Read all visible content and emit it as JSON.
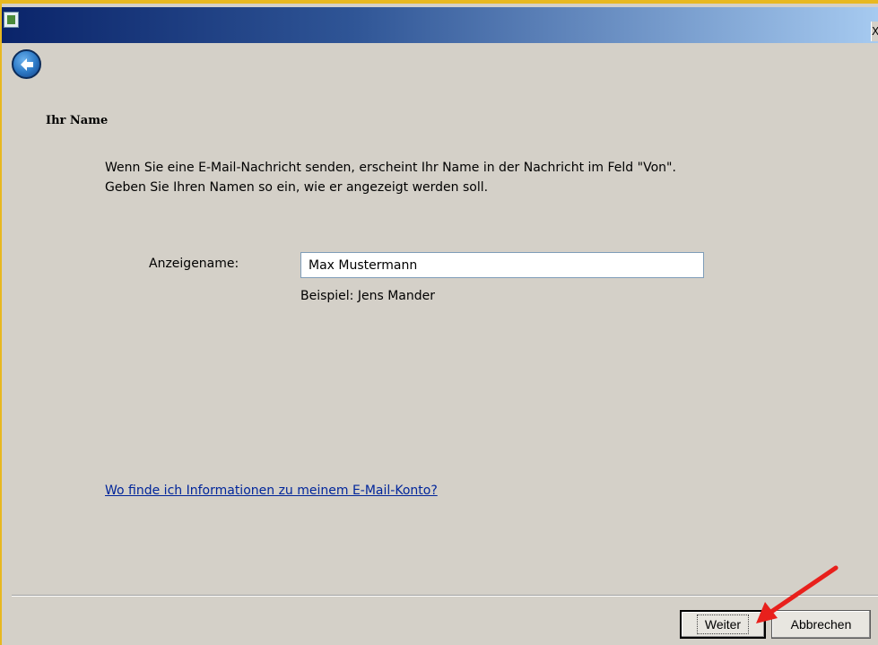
{
  "titlebar": {
    "icon": "app-icon",
    "close_glyph": "X"
  },
  "back_button": {
    "icon": "back-arrow-icon"
  },
  "page": {
    "heading": "Ihr Name",
    "description": "Wenn Sie eine E-Mail-Nachricht senden, erscheint Ihr Name in der Nachricht im Feld \"Von\". Geben Sie Ihren Namen so ein, wie er angezeigt werden soll."
  },
  "form": {
    "display_name_label": "Anzeigename:",
    "display_name_value": "Max Mustermann",
    "example": "Beispiel: Jens Mander"
  },
  "help_link": "Wo finde ich Informationen zu meinem E-Mail-Konto?",
  "buttons": {
    "next": "Weiter",
    "cancel": "Abbrechen"
  },
  "annotation": {
    "arrow_color": "#e8201c"
  },
  "colors": {
    "window_frame": "#e8b820",
    "link": "#00259a",
    "dialog_bg": "#d4d0c8"
  }
}
